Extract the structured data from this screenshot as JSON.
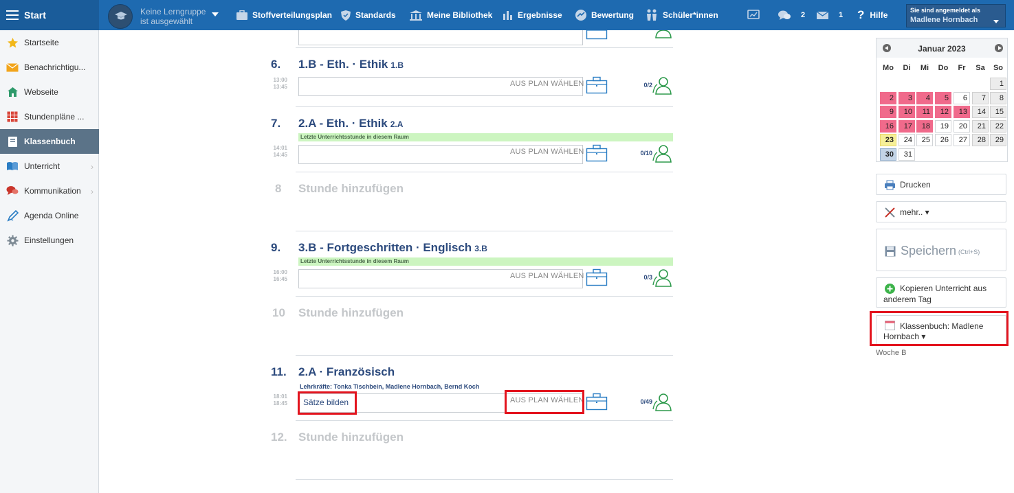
{
  "topbar": {
    "start_label": "Start",
    "lerngruppe": [
      "Keine Lerngruppe",
      "ist ausgewählt"
    ],
    "nav": [
      {
        "label": "Stoffverteilungsplan",
        "icon": "briefcase-icon"
      },
      {
        "label": "Standards",
        "icon": "shield-icon"
      },
      {
        "label": "Meine Bibliothek",
        "icon": "library-icon"
      },
      {
        "label": "Ergebnisse",
        "icon": "bar-chart-icon"
      },
      {
        "label": "Bewertung",
        "icon": "grade-icon"
      },
      {
        "label": "Schüler*innen",
        "icon": "students-icon"
      }
    ],
    "messages_count": "2",
    "mail_count": "1",
    "help_label": "Hilfe",
    "login_label": "Sie sind angemeldet als",
    "login_user": "Madlene Hornbach"
  },
  "sidebar": {
    "items": [
      {
        "label": "Startseite",
        "icon": "star-icon",
        "color": "#f2b81b"
      },
      {
        "label": "Benachrichtigu...",
        "icon": "envelope-icon",
        "color": "#f2a51b"
      },
      {
        "label": "Webseite",
        "icon": "home-icon",
        "color": "#2e9a6b"
      },
      {
        "label": "Stundenpläne ...",
        "icon": "timetable-icon",
        "color": "#d9463a"
      },
      {
        "label": "Klassenbuch",
        "icon": "book-icon",
        "color": "#ffffff"
      },
      {
        "label": "Unterricht",
        "icon": "open-book-icon",
        "color": "#2a7dc4"
      },
      {
        "label": "Kommunikation",
        "icon": "chat-icon",
        "color": "#c9352b"
      },
      {
        "label": "Agenda Online",
        "icon": "pen-icon",
        "color": "#2a7dc4"
      },
      {
        "label": "Einstellungen",
        "icon": "gear-icon",
        "color": "#7d8a94"
      }
    ]
  },
  "lessons": [
    {
      "num": "6.",
      "title": "1.B - Eth. · Ethik",
      "cls": "1.B",
      "time_start": "13:00",
      "time_end": "13:45",
      "info": "",
      "action": "AUS PLAN WÄHLEN",
      "count": "0/2"
    },
    {
      "num": "7.",
      "title": "2.A - Eth. · Ethik",
      "cls": "2.A",
      "time_start": "14:01",
      "time_end": "14:45",
      "info": "Letzte Unterrichtsstunde in diesem Raum",
      "action": "AUS PLAN WÄHLEN",
      "count": "0/10"
    },
    {
      "num": "8",
      "title": "Stunde hinzufügen"
    },
    {
      "num": "9.",
      "title": "3.B - Fortgeschritten · Englisch",
      "cls": "3.B",
      "time_start": "16:00",
      "time_end": "16:45",
      "info": "Letzte Unterrichtsstunde in diesem Raum",
      "action": "AUS PLAN WÄHLEN",
      "count": "0/3"
    },
    {
      "num": "10",
      "title": "Stunde hinzufügen"
    },
    {
      "num": "11.",
      "title": "2.A · Französisch",
      "time_start": "18:01",
      "time_end": "18:45",
      "teachers": "Lehrkräfte:   Tonka Tischbein, Madlene Hornbach, Bernd Koch",
      "input_value": "Sätze bilden",
      "action": "AUS PLAN WÄHLEN",
      "count": "0/49"
    },
    {
      "num": "12.",
      "title": "Stunde hinzufügen"
    }
  ],
  "calendar": {
    "title": "Januar 2023",
    "dow": [
      "Mo",
      "Di",
      "Mi",
      "Do",
      "Fr",
      "Sa",
      "So"
    ],
    "weeks": [
      [
        "",
        "",
        "",
        "",
        "",
        "",
        "1"
      ],
      [
        "2",
        "3",
        "4",
        "5",
        "6",
        "7",
        "8"
      ],
      [
        "9",
        "10",
        "11",
        "12",
        "13",
        "14",
        "15"
      ],
      [
        "16",
        "17",
        "18",
        "19",
        "20",
        "21",
        "22"
      ],
      [
        "23",
        "24",
        "25",
        "26",
        "27",
        "28",
        "29"
      ],
      [
        "30",
        "31",
        "",
        "",
        "",
        "",
        ""
      ]
    ],
    "colors": {
      "highlight": "#f06a8b",
      "today": "#f6f098",
      "selected": "#c3d4e6"
    }
  },
  "actions": {
    "drucken": "Drucken",
    "mehr": "mehr.. ▾",
    "speichern": "Speichern",
    "speichern_hint": "(Ctrl+S)",
    "kopieren": [
      "Kopieren Unterricht aus",
      "anderem Tag"
    ],
    "klassenbuch": [
      "Klassenbuch: Madlene",
      "Hornbach ▾"
    ],
    "woche": "Woche B"
  },
  "colors": {
    "topbar": "#1e6ab0",
    "accent": "#2c4a7d",
    "highlight_box": "#e3141e"
  }
}
